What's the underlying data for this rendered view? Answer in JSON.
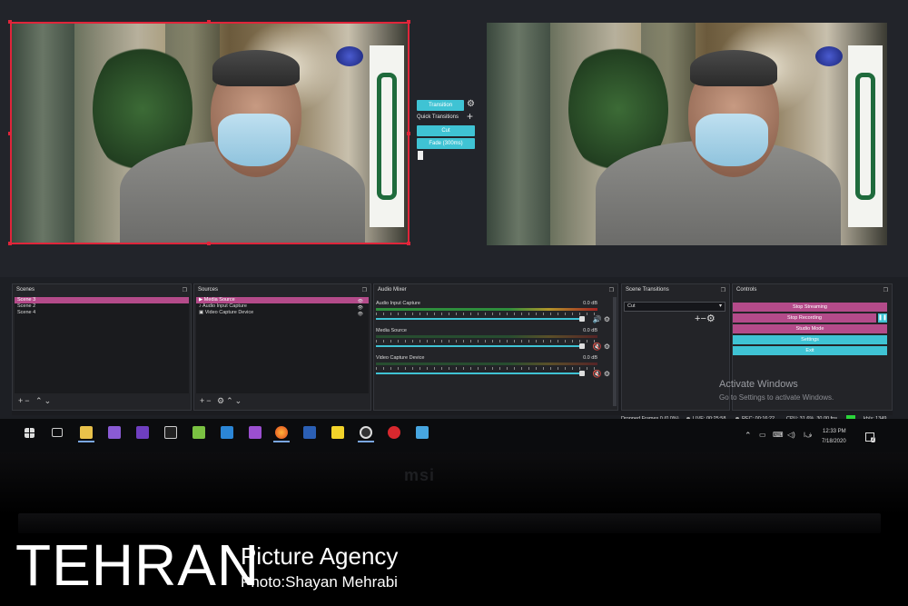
{
  "transitions_panel": {
    "transition_button": "Transition",
    "quick_transitions_label": "Quick Transitions",
    "cut_button": "Cut",
    "fade_button": "Fade (300ms)"
  },
  "docks": {
    "scenes": {
      "title": "Scenes",
      "items": [
        "Scene 3",
        "Scene 2",
        "Scene 4"
      ]
    },
    "sources": {
      "title": "Sources",
      "items": [
        "Media Source",
        "Audio Input Capture",
        "Video Capture Device"
      ]
    },
    "audio_mixer": {
      "title": "Audio Mixer",
      "channels": [
        {
          "name": "Audio Input Capture",
          "db": "0.0 dB"
        },
        {
          "name": "Media Source",
          "db": "0.0 dB"
        },
        {
          "name": "Video Capture Device",
          "db": "0.0 dB"
        }
      ]
    },
    "scene_transitions": {
      "title": "Scene Transitions",
      "selected": "Cut"
    },
    "controls": {
      "title": "Controls",
      "buttons": [
        "Stop Streaming",
        "Stop Recording",
        "Studio Mode",
        "Settings",
        "Exit"
      ]
    }
  },
  "status_bar": {
    "dropped": "Dropped Frames 0 (0.0%)",
    "live": "LIVE: 00:25:58",
    "rec": "REC: 00:16:22",
    "cpu": "CPU: 31.6%, 30.00 fps",
    "kbps": "kb/s: 1349"
  },
  "activate": {
    "title": "Activate Windows",
    "subtitle": "Go to Settings to activate Windows."
  },
  "taskbar": {
    "time": "12:33 PM",
    "date": "7/18/2020",
    "notification_count": "2",
    "lang": "ﻑﺍ"
  },
  "monitor_brand": "msi",
  "watermark": {
    "title": "TEHRAN",
    "subtitle": "Picture Agency",
    "credit": "Photo:Shayan Mehrabi"
  },
  "colors": {
    "accent": "#3fc3d4",
    "active_row": "#b44b8a",
    "control_pink": "#b44b8a",
    "selection": "#e0253a"
  }
}
